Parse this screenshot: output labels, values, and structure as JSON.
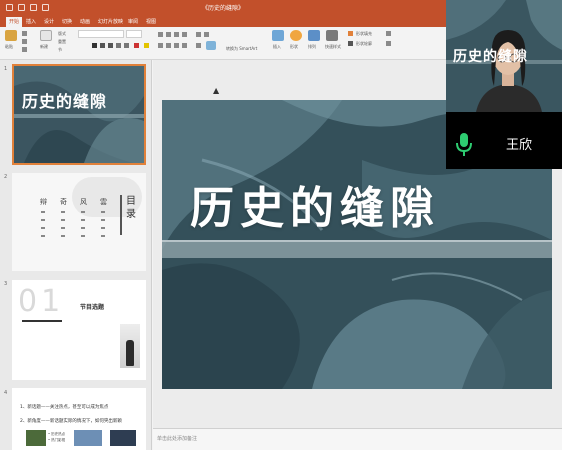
{
  "window": {
    "title": "《历史的缝隙》"
  },
  "menu": {
    "tabs": [
      "开始",
      "插入",
      "设计",
      "切换",
      "动画",
      "幻灯片放映",
      "审阅",
      "视图"
    ],
    "active": 0
  },
  "ribbon": {
    "groups": [
      {
        "name": "paste",
        "label": "粘贴"
      },
      {
        "name": "new-slide",
        "label": "新建"
      },
      {
        "name": "layout",
        "label": "版式"
      },
      {
        "name": "reset",
        "label": "重置"
      },
      {
        "name": "section",
        "label": "节"
      },
      {
        "name": "convert-smartart",
        "label": "转换为 SmartArt"
      },
      {
        "name": "insert-picture",
        "label": "插入"
      },
      {
        "name": "shapes",
        "label": "形状"
      },
      {
        "name": "arrange",
        "label": "排列"
      },
      {
        "name": "quick-styles",
        "label": "快速样式"
      },
      {
        "name": "shape-fill",
        "label": "形状填充"
      },
      {
        "name": "shape-outline",
        "label": "形状轮廓"
      }
    ]
  },
  "slides": [
    {
      "number": "1",
      "title": "历史的缝隙"
    },
    {
      "number": "2",
      "title": "目录",
      "columns": [
        "辩",
        "奇",
        "风",
        "雲"
      ]
    },
    {
      "number": "3",
      "big_number": "01",
      "title": "节目选题"
    },
    {
      "number": "4",
      "lines": [
        "1、新话题——关注热点，甚至可以成为焦点",
        "2、新角度——新话题实际的情况下，如何突出新颖"
      ],
      "bullets": [
        "• 历史热点",
        "• 热门影视"
      ]
    }
  ],
  "main_slide": {
    "title": "历史的缝隙",
    "band_label": ""
  },
  "notes": {
    "placeholder": "单击此处添加备注"
  },
  "webcam": {
    "name": "王欣",
    "mic_icon": "microphone-icon",
    "mic_color": "#2ecc71"
  }
}
